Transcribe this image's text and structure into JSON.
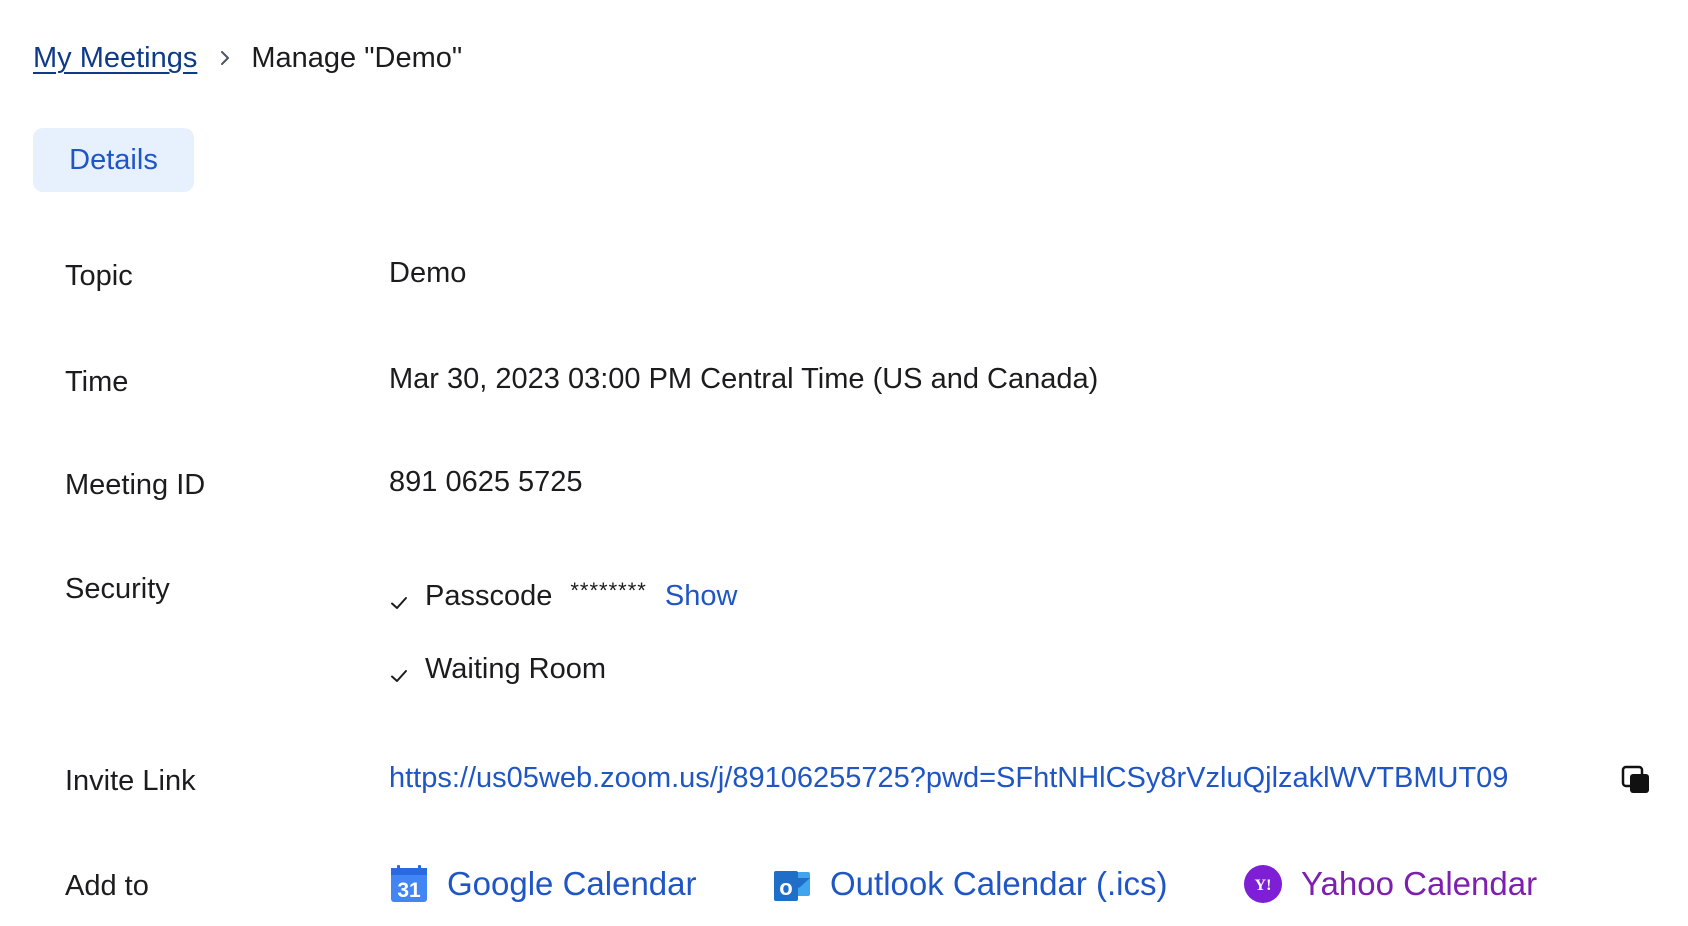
{
  "breadcrumb": {
    "parent": "My Meetings",
    "current": "Manage \"Demo\""
  },
  "tabs": {
    "details": "Details"
  },
  "rows": {
    "topic": {
      "label": "Topic",
      "value": "Demo"
    },
    "time": {
      "label": "Time",
      "value": "Mar 30, 2023 03:00 PM Central Time (US and Canada)"
    },
    "meeting_id": {
      "label": "Meeting ID",
      "value": "891 0625 5725"
    },
    "security": {
      "label": "Security",
      "passcode_label": "Passcode",
      "passcode_masked": "********",
      "show_label": "Show",
      "waiting_room_label": "Waiting Room"
    },
    "invite_link": {
      "label": "Invite Link",
      "url": "https://us05web.zoom.us/j/89106255725?pwd=SFhtNHlCSy8rVzluQjlzaklWVTBMUT09"
    },
    "add_to": {
      "label": "Add to",
      "google": "Google Calendar",
      "google_icon_text": "31",
      "outlook": "Outlook Calendar (.ics)",
      "outlook_icon_text": "o",
      "yahoo": "Yahoo Calendar",
      "yahoo_icon_text": "Y!"
    }
  },
  "colors": {
    "link_blue": "#1f56c6",
    "breadcrumb_blue": "#0e3a8a",
    "tab_bg": "#e7f0fd",
    "yahoo_purple": "#7e1fb0",
    "outlook_blue": "#1f6fc9",
    "google_blue": "#4285f4"
  },
  "icons": {
    "breadcrumb_separator": "chevron-right-icon",
    "check": "check-icon",
    "copy": "copy-icon",
    "google": "google-calendar-icon",
    "outlook": "outlook-icon",
    "yahoo": "yahoo-icon"
  }
}
